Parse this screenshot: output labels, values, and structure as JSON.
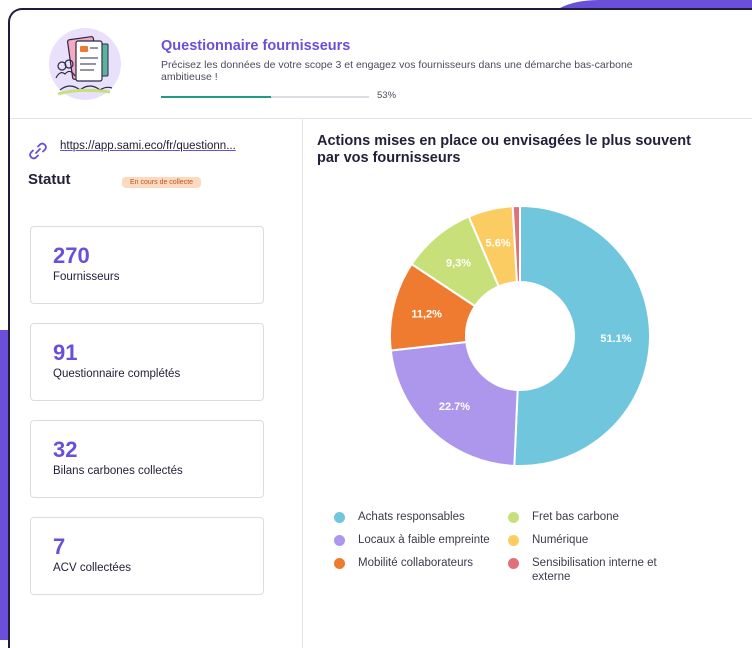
{
  "header": {
    "title": "Questionnaire fournisseurs",
    "description": "Précisez les données de votre scope 3 et engagez vos fournisseurs dans une démarche bas-carbone ambitieuse !",
    "progress_label": "53%",
    "progress_value": 0.53,
    "illustration_icon": "questionnaire-illustration"
  },
  "left": {
    "link_icon": "link-icon",
    "link_text": "https://app.sami.eco/fr/questionn...",
    "statut_label": "Statut",
    "statut_badge": "En cours de collecte",
    "stats": [
      {
        "value": "270",
        "label": "Fournisseurs"
      },
      {
        "value": "91",
        "label": "Questionnaire complétés"
      },
      {
        "value": "32",
        "label": "Bilans carbones collectés"
      },
      {
        "value": "7",
        "label": "ACV collectées"
      }
    ]
  },
  "colors": {
    "accent": "#6b4fd8",
    "badge_bg": "#fcd9c1",
    "badge_text": "#c2541c",
    "progress": "#1f9a83"
  },
  "chart_data": {
    "type": "pie",
    "title": "Actions mises en place ou envisagées le plus souvent par vos fournisseurs",
    "donut": true,
    "legend_position": "bottom",
    "series": [
      {
        "name": "Achats responsables",
        "value": 51.1,
        "label": "51.1%",
        "color": "#70c6dd"
      },
      {
        "name": "Locaux à faible empreinte",
        "value": 22.7,
        "label": "22.7%",
        "color": "#ac97ec"
      },
      {
        "name": "Mobilité collaborateurs",
        "value": 11.2,
        "label": "11,2%",
        "color": "#ee7b2f"
      },
      {
        "name": "Fret bas carbone",
        "value": 9.3,
        "label": "9,3%",
        "color": "#c7e07a"
      },
      {
        "name": "Numérique",
        "value": 5.6,
        "label": "5.6%",
        "color": "#fbcc61"
      },
      {
        "name": "Sensibilisation interne et externe",
        "value": 0.9,
        "label": "",
        "color": "#e17079"
      }
    ]
  }
}
